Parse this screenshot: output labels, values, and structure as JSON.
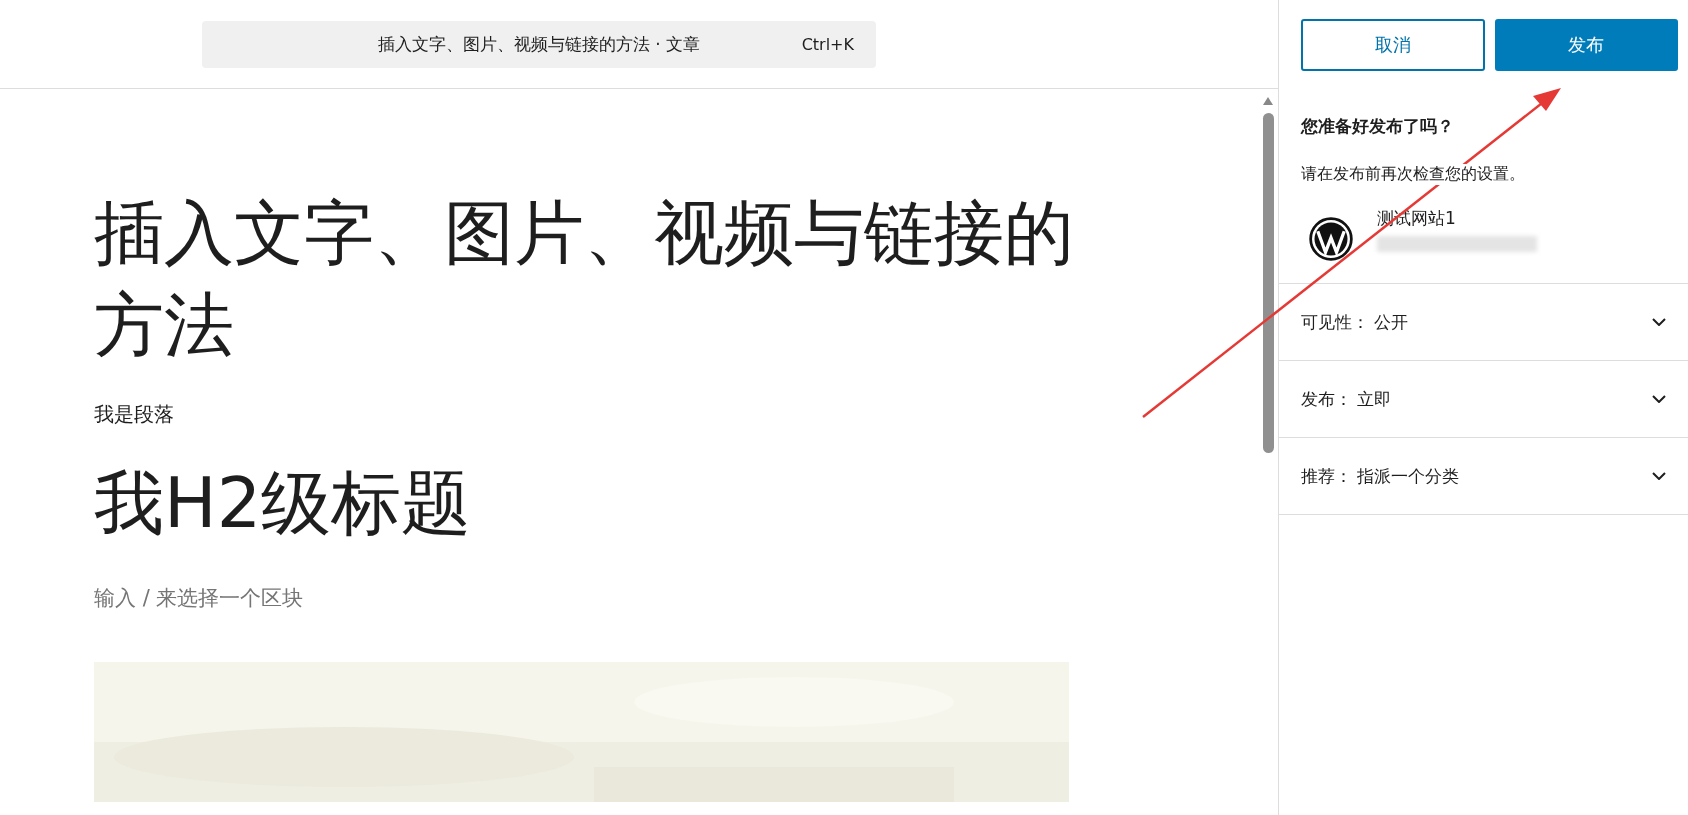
{
  "command_bar": {
    "title": "插入文字、图片、视频与链接的方法 · 文章",
    "shortcut": "Ctrl+K"
  },
  "editor": {
    "title": "插入文字、图片、视频与链接的方法",
    "blocks": [
      {
        "kind": "paragraph",
        "text": "我是段落"
      },
      {
        "kind": "heading",
        "text": "我H2级标题"
      },
      {
        "kind": "placeholder",
        "text": "输入 / 来选择一个区块"
      },
      {
        "kind": "picture"
      }
    ]
  },
  "header_buttons": [
    {
      "label": "取消",
      "kind": "secondary"
    },
    {
      "label": "发布",
      "kind": "primary"
    }
  ],
  "publish_panel": {
    "heading": "您准备好发布了吗？",
    "subheading": "请在发布前再次检查您的设置。",
    "site_name": "测试网站1",
    "settings": [
      {
        "label": "可见性：",
        "value": "公开",
        "expanded": false
      },
      {
        "label": "发布：",
        "value": "立即",
        "expanded": false
      },
      {
        "label": "推荐：",
        "value": "指派一个分类",
        "expanded": false
      }
    ]
  }
}
